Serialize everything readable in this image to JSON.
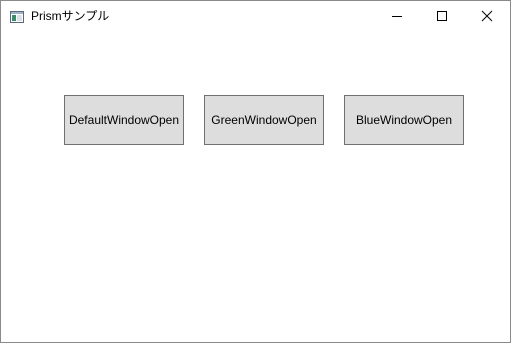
{
  "window": {
    "title": "Prismサンプル",
    "controls": {
      "minimize_icon": "minimize-icon",
      "maximize_icon": "maximize-icon",
      "close_icon": "close-icon"
    }
  },
  "main": {
    "buttons": [
      {
        "label": "DefaultWindowOpen"
      },
      {
        "label": "GreenWindowOpen"
      },
      {
        "label": "BlueWindowOpen"
      }
    ]
  },
  "colors": {
    "button_face": "#dddddd",
    "button_border": "#707070",
    "window_background": "#ffffff"
  }
}
